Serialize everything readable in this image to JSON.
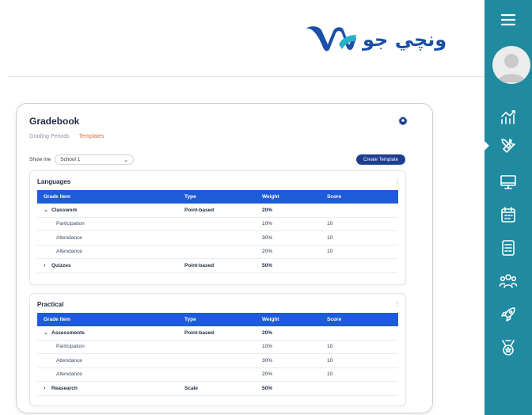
{
  "brand": {
    "name": "ونچي جو",
    "primary_color": "#1b4fa8",
    "accent_color": "#1f8aa0"
  },
  "sidebar": {
    "items": [
      {
        "icon": "menu-icon"
      },
      {
        "icon": "avatar-icon"
      },
      {
        "icon": "chart-icon"
      },
      {
        "icon": "tools-icon",
        "active": true
      },
      {
        "icon": "monitor-icon"
      },
      {
        "icon": "calendar-icon"
      },
      {
        "icon": "document-icon"
      },
      {
        "icon": "users-icon"
      },
      {
        "icon": "rocket-icon"
      },
      {
        "icon": "medal-icon"
      }
    ]
  },
  "gradebook": {
    "title": "Gradebook",
    "tabs": [
      {
        "label": "Grading Periods",
        "active": false
      },
      {
        "label": "Templates",
        "active": true
      }
    ],
    "show_me_label": "Show me",
    "school_select": "School 1",
    "create_template_label": "Create Template",
    "columns": [
      "Grade Item",
      "Type",
      "Weight",
      "Score"
    ],
    "sections": [
      {
        "title": "Languages",
        "rows": [
          {
            "kind": "group",
            "expanded": true,
            "item": "Classwork",
            "type": "Point-based",
            "weight": "20%",
            "score": ""
          },
          {
            "kind": "sub",
            "item": "Participation",
            "type": "",
            "weight": "10%",
            "score": "10"
          },
          {
            "kind": "sub",
            "item": "Attendance",
            "type": "",
            "weight": "30%",
            "score": "10"
          },
          {
            "kind": "sub",
            "item": "Attendance",
            "type": "",
            "weight": "20%",
            "score": "10"
          },
          {
            "kind": "group",
            "expanded": false,
            "item": "Quizzes",
            "type": "Point-based",
            "weight": "50%",
            "score": ""
          }
        ]
      },
      {
        "title": "Practical",
        "rows": [
          {
            "kind": "group",
            "expanded": true,
            "item": "Assessments",
            "type": "Point-based",
            "weight": "20%",
            "score": ""
          },
          {
            "kind": "sub",
            "item": "Participation",
            "type": "",
            "weight": "10%",
            "score": "10"
          },
          {
            "kind": "sub",
            "item": "Attendance",
            "type": "",
            "weight": "30%",
            "score": "10"
          },
          {
            "kind": "sub",
            "item": "Attendance",
            "type": "",
            "weight": "20%",
            "score": "10"
          },
          {
            "kind": "group",
            "expanded": false,
            "item": "Reasearch",
            "type": "Scale",
            "weight": "50%",
            "score": ""
          }
        ]
      }
    ]
  }
}
